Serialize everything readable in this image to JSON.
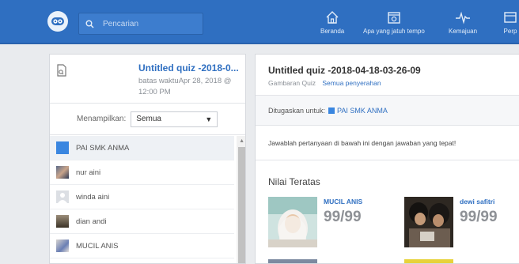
{
  "topbar": {
    "search_placeholder": "Pencarian",
    "nav": [
      {
        "label": "Beranda",
        "icon": "home-icon"
      },
      {
        "label": "Apa yang jatuh tempo",
        "icon": "calendar-icon"
      },
      {
        "label": "Kemajuan",
        "icon": "pulse-icon"
      },
      {
        "label": "Perp",
        "icon": "library-icon"
      }
    ],
    "brand_color": "#2f6fc1"
  },
  "quiz_list": {
    "title": "Untitled quiz -2018-0...",
    "due": "batas waktuApr 28, 2018 @ 12:00 PM",
    "filter_label": "Menampilkan:",
    "filter_value": "Semua",
    "students": [
      {
        "name": "PAI SMK ANMA",
        "avatar": "group-icon"
      },
      {
        "name": "nur aini",
        "avatar": "photo"
      },
      {
        "name": "winda aini",
        "avatar": "default-avatar-icon"
      },
      {
        "name": "dian andi",
        "avatar": "photo"
      },
      {
        "name": "MUCIL ANIS",
        "avatar": "photo"
      }
    ]
  },
  "detail": {
    "title": "Untitled quiz -2018-04-18-03-26-09",
    "subtitle": "Gambaran Quiz",
    "submissions_link": "Semua penyerahan",
    "assigned_label": "Ditugaskan untuk:",
    "assigned_group": "PAI SMK ANMA",
    "instruction": "Jawablah pertanyaan di bawah ini dengan jawaban yang tepat!",
    "top_scores_label": "Nilai Teratas",
    "top_scores": [
      {
        "name": "MUCIL ANIS",
        "score": "99/99"
      },
      {
        "name": "dewi safitri",
        "score": "99/99"
      }
    ]
  }
}
